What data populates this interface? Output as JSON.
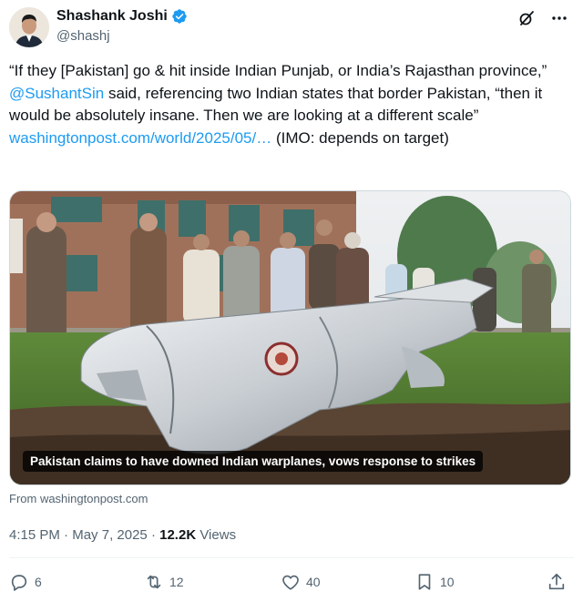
{
  "author": {
    "display_name": "Shashank Joshi",
    "handle": "@shashj",
    "verified": true
  },
  "tweet": {
    "text_part1": "“If they [Pakistan] go & hit inside Indian Punjab, or India’s Rajasthan province,” ",
    "mention": "@SushantSin",
    "text_part2": " said, referencing two Indian states that border Pakistan, “then it would be absolutely insane. Then we are looking at a different scale” ",
    "link": "washingtonpost.com/world/2025/05/…",
    "text_part3": " (IMO: depends on target)"
  },
  "media": {
    "caption": "Pakistan claims to have downed Indian warplanes, vows response to strikes",
    "source": "From washingtonpost.com"
  },
  "meta": {
    "time": "4:15 PM",
    "separator": " · ",
    "date": "May 7, 2025",
    "views_count": "12.2K",
    "views_label": " Views"
  },
  "actions": {
    "replies": "6",
    "retweets": "12",
    "likes": "40",
    "bookmarks": "10"
  },
  "colors": {
    "accent": "#1d9bf0",
    "text": "#0f1419",
    "muted": "#536471"
  }
}
